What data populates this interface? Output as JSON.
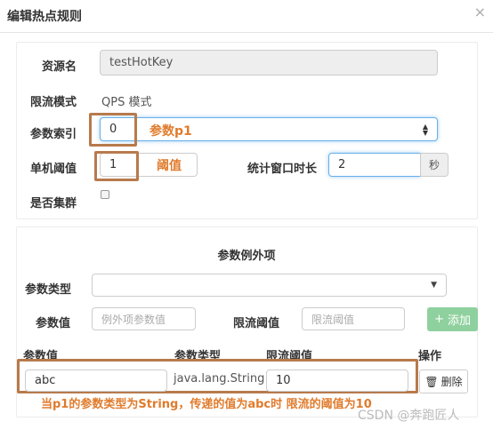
{
  "modal": {
    "title": "编辑热点规则",
    "close": "×"
  },
  "form": {
    "resource": {
      "label": "资源名",
      "value": "testHotKey"
    },
    "mode": {
      "label": "限流模式",
      "value": "QPS 模式"
    },
    "param_index": {
      "label": "参数索引",
      "value": "0"
    },
    "threshold": {
      "label": "单机阈值",
      "value": "1"
    },
    "window": {
      "label": "统计窗口时长",
      "value": "2",
      "unit": "秒"
    },
    "cluster": {
      "label": "是否集群",
      "checked": false
    }
  },
  "exceptions": {
    "section_title": "参数例外项",
    "param_type": {
      "label": "参数类型",
      "value": ""
    },
    "param_value": {
      "label": "参数值",
      "placeholder": "例外项参数值"
    },
    "limit": {
      "label": "限流阈值",
      "placeholder": "限流阈值"
    },
    "add_button": "添加",
    "table": {
      "headers": [
        "参数值",
        "参数类型",
        "限流阈值",
        "操作"
      ],
      "rows": [
        {
          "value": "abc",
          "type": "java.lang.String",
          "limit": "10",
          "action": "删除"
        }
      ]
    }
  },
  "annotations": {
    "param_index": "参数p1",
    "threshold": "阈值",
    "footer": "当p1的参数类型为String，传递的值为abc时  限流的阈值为10"
  },
  "watermark": "CSDN @奔跑匠人",
  "colors": {
    "annotation_box": "#b77a4c",
    "annotation_text": "#e07b2c",
    "add_button": "#8fd19e",
    "focus_border": "#66afe9"
  }
}
